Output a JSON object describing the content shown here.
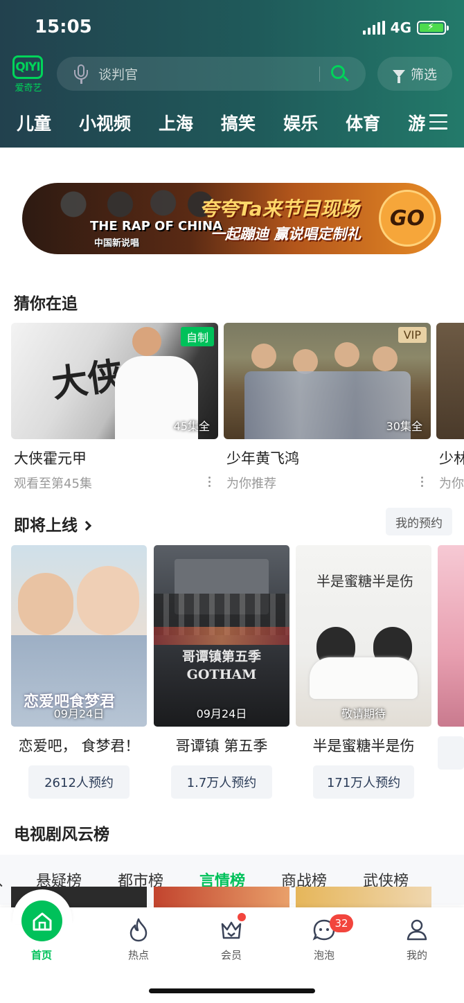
{
  "status": {
    "time": "15:05",
    "network": "4G"
  },
  "header": {
    "logo_mark": "QIYI",
    "logo_text": "爱奇艺",
    "search_placeholder": "谈判官",
    "filter_label": "筛选",
    "channels": [
      "儿童",
      "小视频",
      "上海",
      "搞笑",
      "娱乐",
      "体育",
      "游"
    ]
  },
  "banner": {
    "line1": "夸夸Ta来节目现场",
    "line2": "一起蹦迪 赢说唱定制礼",
    "show_name": "THE RAP OF CHINA",
    "show_sub": "中国新说唱",
    "go": "GO"
  },
  "watching": {
    "title": "猜你在追",
    "items": [
      {
        "title": "大侠霍元甲",
        "sub": "观看至第45集",
        "badge": "自制",
        "episodes": "45集全",
        "poster_text": "大侠"
      },
      {
        "title": "少年黄飞鸿",
        "sub": "为你推荐",
        "badge": "VIP",
        "episodes": "30集全",
        "poster_text": ""
      },
      {
        "title": "少林",
        "sub": "为你",
        "badge": "",
        "episodes": "",
        "poster_text": ""
      }
    ]
  },
  "upcoming": {
    "title": "即将上线",
    "my_reserve": "我的预约",
    "items": [
      {
        "title": "恋爱吧， 食梦君！",
        "date": "09月24日",
        "reserve": "2612人预约",
        "poster_text": "恋爱吧食梦君"
      },
      {
        "title": "哥谭镇 第五季",
        "date": "09月24日",
        "reserve": "1.7万人预约",
        "poster_text": "哥谭镇第五季 GOTHAM"
      },
      {
        "title": "半是蜜糖半是伤",
        "date": "敬请期待",
        "reserve": "171万人预约",
        "poster_text": "半是蜜糖半是伤"
      }
    ]
  },
  "ranking": {
    "title": "电视剧风云榜",
    "tabs": [
      "悬疑榜",
      "都市榜",
      "言情榜",
      "商战榜",
      "武侠榜"
    ],
    "active_tab": "言情榜"
  },
  "bottom_nav": {
    "items": [
      "首页",
      "热点",
      "会员",
      "泡泡",
      "我的"
    ],
    "bubble_count": "32"
  },
  "colors": {
    "accent": "#00c15a",
    "header_start": "#22414e",
    "header_end": "#237a6a",
    "badge_red": "#f2453d"
  }
}
